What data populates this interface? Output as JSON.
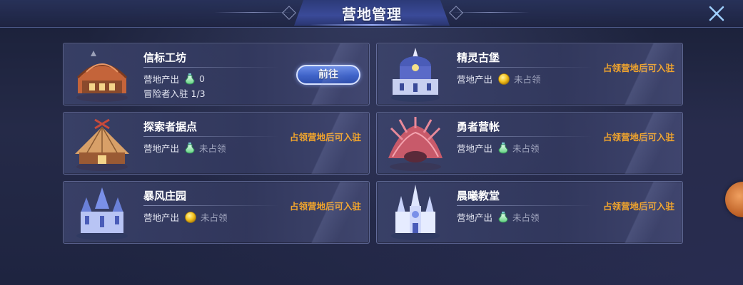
{
  "header": {
    "title": "营地管理"
  },
  "camps": [
    {
      "name": "信标工坊",
      "output_label": "营地产出",
      "output_icon": "potion-icon",
      "output_value": "0",
      "adventurers_label": "冒险者入驻",
      "adventurers_value": "1/3",
      "action_label": "前往"
    },
    {
      "name": "精灵古堡",
      "output_label": "营地产出",
      "output_icon": "gold-coin-icon",
      "output_value": "未占领",
      "condition": "占领营地后可入驻"
    },
    {
      "name": "探索者据点",
      "output_label": "营地产出",
      "output_icon": "potion-icon",
      "output_value": "未占领",
      "condition": "占领营地后可入驻"
    },
    {
      "name": "勇者营帐",
      "output_label": "营地产出",
      "output_icon": "potion-icon",
      "output_value": "未占领",
      "condition": "占领营地后可入驻"
    },
    {
      "name": "暴风庄园",
      "output_label": "营地产出",
      "output_icon": "gold-coin-icon",
      "output_value": "未占领",
      "condition": "占领营地后可入驻"
    },
    {
      "name": "晨曦教堂",
      "output_label": "营地产出",
      "output_icon": "potion-icon",
      "output_value": "未占领",
      "condition": "占领营地后可入驻"
    }
  ],
  "colors": {
    "condition": "#f2a52c",
    "accent": "#3f63c8",
    "background": "#1e2440"
  }
}
